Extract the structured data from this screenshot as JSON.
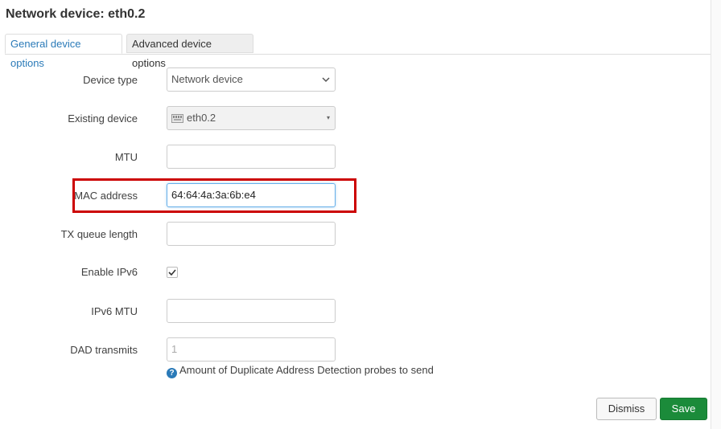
{
  "dialog": {
    "title": "Network device: eth0.2"
  },
  "tabs": [
    {
      "label": "General device options",
      "active": true
    },
    {
      "label": "Advanced device options",
      "active": false
    }
  ],
  "fields": {
    "device_type": {
      "label": "Device type",
      "value": "Network device"
    },
    "existing_device": {
      "label": "Existing device",
      "value": "eth0.2"
    },
    "mtu": {
      "label": "MTU",
      "value": ""
    },
    "mac_address": {
      "label": "MAC address",
      "value": "64:64:4a:3a:6b:e4"
    },
    "tx_queue_length": {
      "label": "TX queue length",
      "value": ""
    },
    "enable_ipv6": {
      "label": "Enable IPv6",
      "checked": true
    },
    "ipv6_mtu": {
      "label": "IPv6 MTU",
      "value": ""
    },
    "dad_transmits": {
      "label": "DAD transmits",
      "placeholder": "1",
      "help": "Amount of Duplicate Address Detection probes to send"
    }
  },
  "buttons": {
    "dismiss": "Dismiss",
    "save": "Save"
  },
  "colors": {
    "accent": "#2a7ab8",
    "save": "#1b8b3a",
    "highlight": "#cc0000"
  },
  "icons": {
    "device_type": "chevron-down-icon",
    "existing_device": "network-port-icon",
    "help": "question-circle-icon",
    "checkbox": "check-icon"
  }
}
